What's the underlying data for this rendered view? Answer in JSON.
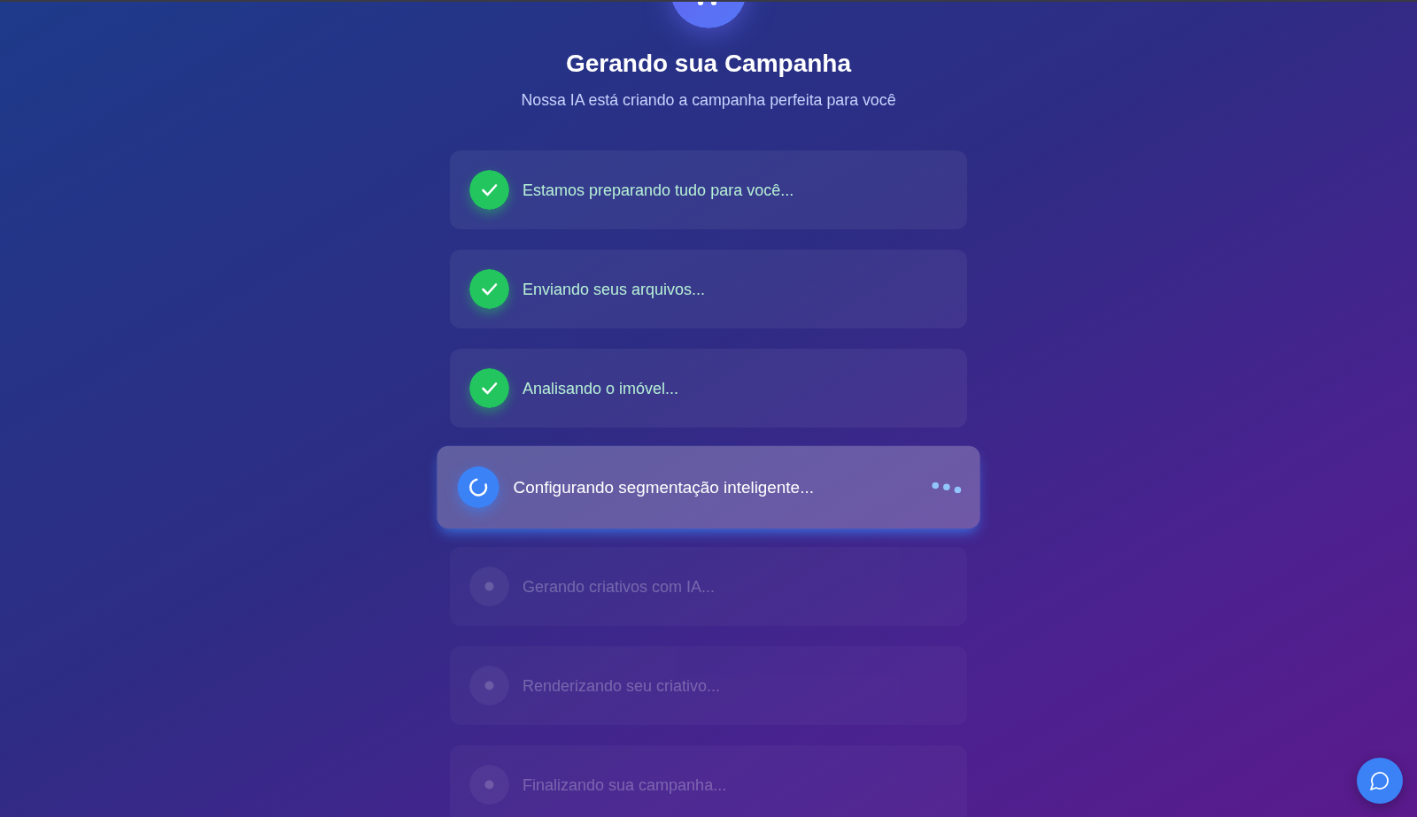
{
  "header": {
    "title": "Gerando sua Campanha",
    "subtitle": "Nossa IA está criando a campanha perfeita para você"
  },
  "steps": [
    {
      "label": "Estamos preparando tudo para você...",
      "done": true,
      "active": false
    },
    {
      "label": "Enviando seus arquivos...",
      "done": true,
      "active": false
    },
    {
      "label": "Analisando o imóvel...",
      "done": true,
      "active": false
    },
    {
      "label": "Configurando segmentação inteligente...",
      "done": false,
      "active": true
    },
    {
      "label": "Gerando criativos com IA...",
      "done": false,
      "active": false
    },
    {
      "label": "Renderizando seu criativo...",
      "done": false,
      "active": false
    },
    {
      "label": "Finalizando sua campanha...",
      "done": false,
      "active": false
    }
  ]
}
